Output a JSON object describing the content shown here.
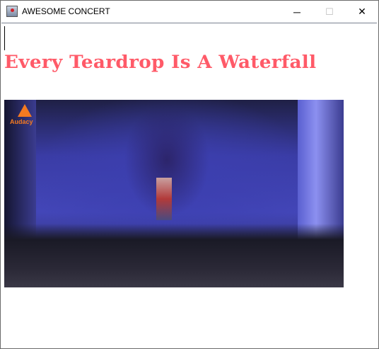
{
  "window": {
    "title": "AWESOME CONCERT",
    "minimize": "─",
    "maximize": "☐",
    "close": "✕"
  },
  "content": {
    "song_title": "Every Teardrop Is A Waterfall",
    "video": {
      "logo_text": "Audacy",
      "description_icon": "concert-video-frame"
    }
  },
  "colors": {
    "song_title": "#ff5a68",
    "logo": "#f47a20"
  }
}
